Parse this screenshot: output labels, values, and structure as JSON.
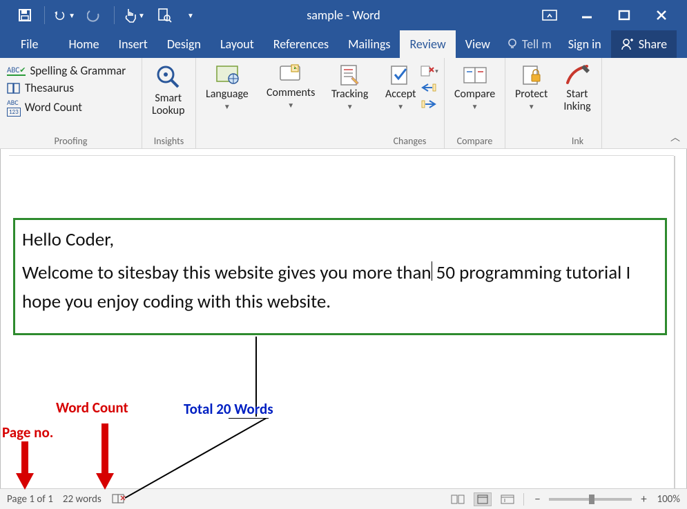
{
  "title": "sample - Word",
  "menu": {
    "file": "File",
    "home": "Home",
    "insert": "Insert",
    "design": "Design",
    "layout": "Layout",
    "references": "References",
    "mailings": "Mailings",
    "review": "Review",
    "view": "View",
    "tellme": "Tell m",
    "signin": "Sign in",
    "share": "Share"
  },
  "ribbon": {
    "proofing": {
      "spelling": "Spelling & Grammar",
      "thesaurus": "Thesaurus",
      "wordcount": "Word Count",
      "label": "Proofing"
    },
    "insights": {
      "smart_lookup": "Smart\nLookup",
      "label": "Insights"
    },
    "language": {
      "btn": "Language",
      "label": ""
    },
    "comments": {
      "btn": "Comments",
      "label": ""
    },
    "tracking": {
      "btn": "Tracking",
      "label": ""
    },
    "changes": {
      "accept": "Accept",
      "label": "Changes"
    },
    "compare": {
      "btn": "Compare",
      "label": "Compare"
    },
    "protect": {
      "btn": "Protect",
      "label": ""
    },
    "ink": {
      "btn": "Start\nInking",
      "label": "Ink"
    }
  },
  "document": {
    "greeting": "Hello Coder,",
    "body1a": "Welcome to sitesbay this website gives you more than",
    "body1b": " 50 programming tutorial I hope you enjoy coding with this website."
  },
  "annotations": {
    "page_no": "Page no.",
    "word_count": "Word Count",
    "total_words": "Total 20 Words"
  },
  "status": {
    "page": "Page 1 of 1",
    "words": "22 words",
    "zoom": "100%"
  }
}
